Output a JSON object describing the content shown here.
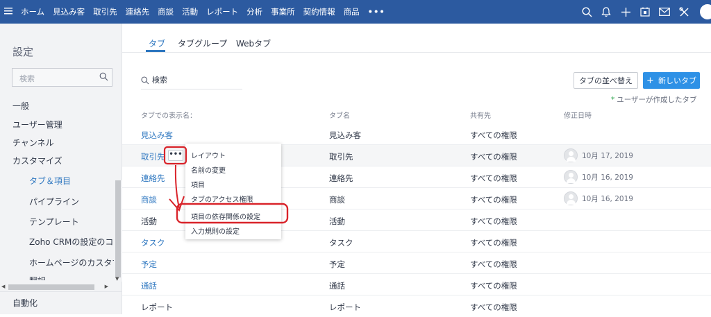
{
  "topbar": {
    "menu_icon": "hamburger-icon",
    "nav": [
      "ホーム",
      "見込み客",
      "取引先",
      "連絡先",
      "商談",
      "活動",
      "レポート",
      "分析",
      "事業所",
      "契約情報",
      "商品"
    ],
    "more": "•••",
    "icons": [
      "search-icon",
      "bell-icon",
      "plus-icon",
      "calendar-icon",
      "mail-icon",
      "tools-icon",
      "avatar-icon"
    ],
    "bar_color": "#2c5aa0"
  },
  "sidebar": {
    "title": "設定",
    "search_placeholder": "検索",
    "items": [
      "一般",
      "ユーザー管理",
      "チャンネル",
      "カスタマイズ"
    ],
    "subitems": [
      "タブ＆項目",
      "パイプライン",
      "テンプレート",
      "Zoho CRMの設定のコピー",
      "ホームページのカスタマイズ",
      "翻訳"
    ],
    "bottom_item": "自動化"
  },
  "tabs": [
    "タブ",
    "タブグループ",
    "Webタブ"
  ],
  "search": {
    "placeholder": "検索"
  },
  "buttons": {
    "sort": "タブの並べ替え",
    "new": "新しいタブ",
    "new_color": "#2e91e6"
  },
  "note": {
    "star": "*",
    "text": "ユーザーが作成したタブ"
  },
  "table": {
    "headers": [
      "タブでの表示名：",
      "タブ名",
      "共有先",
      "修正日時"
    ],
    "rows": [
      {
        "display": "見込み客",
        "name": "見込み客",
        "shared": "すべての権限",
        "date": ""
      },
      {
        "display": "取引先",
        "name": "取引先",
        "shared": "すべての権限",
        "date": "10月 17, 2019"
      },
      {
        "display": "連絡先",
        "name": "連絡先",
        "shared": "すべての権限",
        "date": "10月 16, 2019"
      },
      {
        "display": "商談",
        "name": "商談",
        "shared": "すべての権限",
        "date": "10月 16, 2019"
      },
      {
        "display": "活動",
        "name": "活動",
        "shared": "すべての権限",
        "date": ""
      },
      {
        "display": "タスク",
        "name": "タスク",
        "shared": "すべての権限",
        "date": ""
      },
      {
        "display": "予定",
        "name": "予定",
        "shared": "すべての権限",
        "date": ""
      },
      {
        "display": "通話",
        "name": "通話",
        "shared": "すべての権限",
        "date": ""
      },
      {
        "display": "レポート",
        "name": "レポート",
        "shared": "すべての権限",
        "date": ""
      }
    ]
  },
  "context_menu": {
    "trigger": "•••",
    "items": [
      "レイアウト",
      "名前の変更",
      "項目",
      "タブのアクセス権限",
      "項目の依存関係の設定",
      "入力規則の設定"
    ],
    "highlight_color": "#d9232a"
  },
  "accent": "#2e77c0"
}
